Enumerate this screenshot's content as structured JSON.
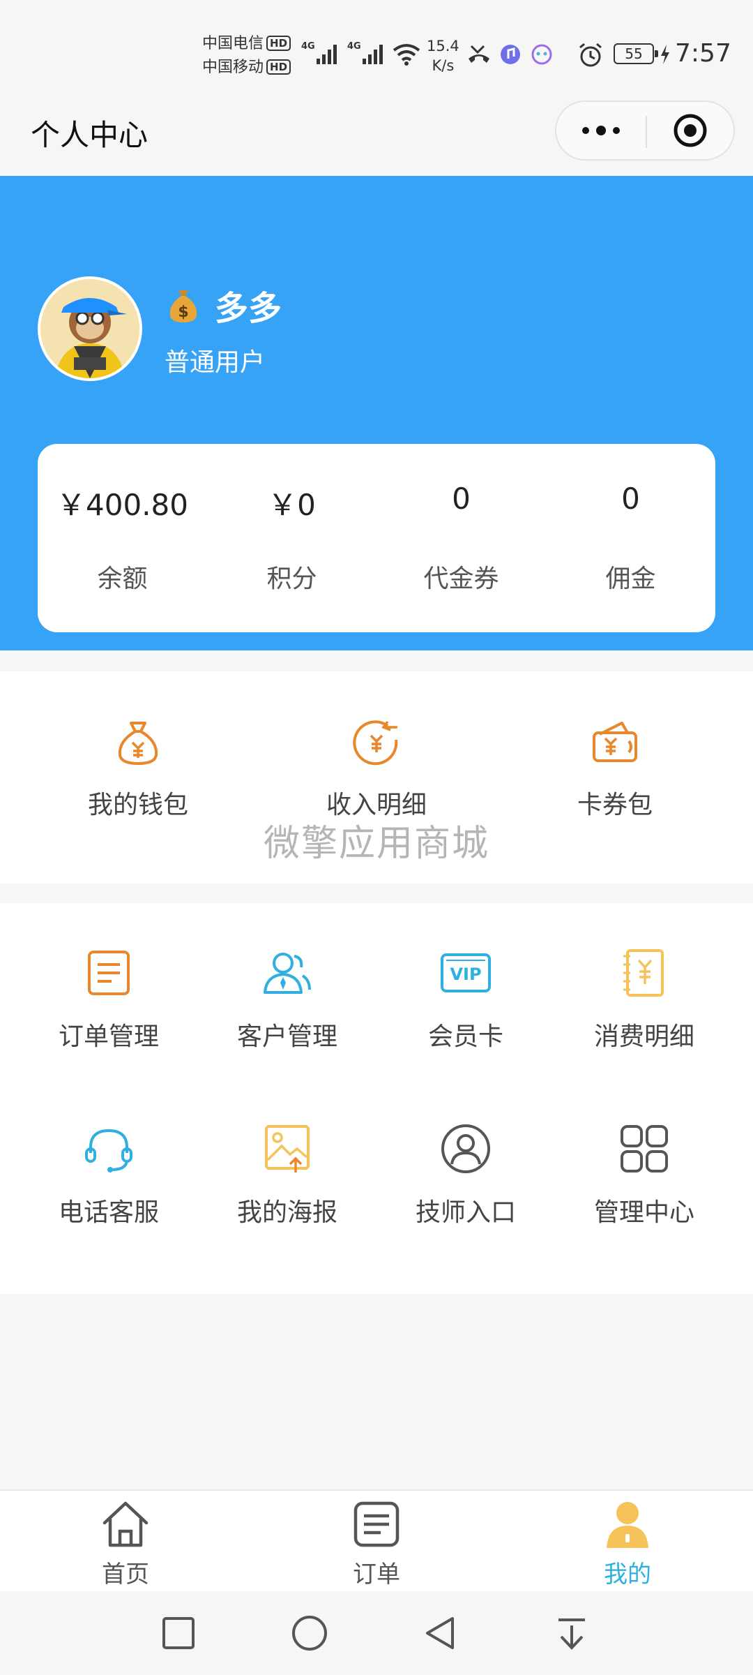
{
  "status": {
    "carrier1": "中国电信",
    "carrier2": "中国移动",
    "hd": "HD",
    "network": "4G",
    "speed_value": "15.4",
    "speed_unit": "K/s",
    "battery": "55",
    "time": "7:57"
  },
  "header": {
    "title": "个人中心"
  },
  "profile": {
    "name": "多多",
    "role": "普通用户",
    "bg_color": "#36a3f7",
    "stats": [
      {
        "value": "￥400.80",
        "label": "余额"
      },
      {
        "value": "￥0",
        "label": "积分"
      },
      {
        "value": "0",
        "label": "代金券"
      },
      {
        "value": "0",
        "label": "佣金"
      }
    ]
  },
  "wallet": {
    "items": [
      {
        "label": "我的钱包",
        "icon": "money-bag-icon"
      },
      {
        "label": "收入明细",
        "icon": "income-icon"
      },
      {
        "label": "卡券包",
        "icon": "coupon-wallet-icon"
      }
    ],
    "accent": "#e8872b"
  },
  "watermark": "微擎应用商城",
  "tools": {
    "items": [
      {
        "label": "订单管理",
        "icon": "order-doc-icon"
      },
      {
        "label": "客户管理",
        "icon": "customers-icon"
      },
      {
        "label": "会员卡",
        "icon": "vip-card-icon"
      },
      {
        "label": "消费明细",
        "icon": "consumption-icon"
      },
      {
        "label": "电话客服",
        "icon": "headset-icon"
      },
      {
        "label": "我的海报",
        "icon": "poster-icon"
      },
      {
        "label": "技师入口",
        "icon": "user-circle-icon"
      },
      {
        "label": "管理中心",
        "icon": "grid-icon"
      }
    ]
  },
  "tabbar": {
    "items": [
      {
        "label": "首页",
        "icon": "home-icon"
      },
      {
        "label": "订单",
        "icon": "order-icon"
      },
      {
        "label": "我的",
        "icon": "user-icon"
      }
    ],
    "active_color": "#2fb0e0",
    "active_index": 2
  }
}
